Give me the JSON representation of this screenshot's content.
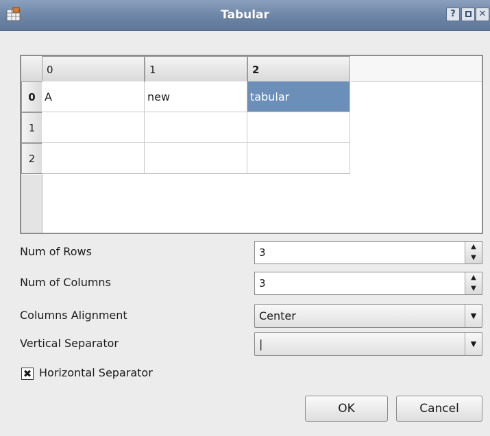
{
  "window": {
    "title": "Tabular",
    "help_label": "?",
    "close_label": "✕"
  },
  "table": {
    "columns": [
      "0",
      "1",
      "2"
    ],
    "rows": [
      "0",
      "1",
      "2"
    ],
    "cells": [
      [
        "A",
        "new",
        "tabular"
      ],
      [
        "",
        "",
        ""
      ],
      [
        "",
        "",
        ""
      ]
    ],
    "selected": {
      "row": 0,
      "col": 2
    },
    "selected_color": "#6b8fb8"
  },
  "form": {
    "rows_label": "Num of Rows",
    "rows_value": "3",
    "cols_label": "Num of Columns",
    "cols_value": "3",
    "align_label": "Columns Alignment",
    "align_value": "Center",
    "vsep_label": "Vertical Separator",
    "vsep_value": "|",
    "hsep_label": "Horizontal Separator",
    "hsep_checked": true
  },
  "buttons": {
    "ok": "OK",
    "cancel": "Cancel"
  },
  "icons": {
    "app": "table-app-icon",
    "spin_up": "arrow-up-icon",
    "spin_down": "arrow-down-icon",
    "dropdown": "chevron-down-icon",
    "check": "check-icon"
  }
}
